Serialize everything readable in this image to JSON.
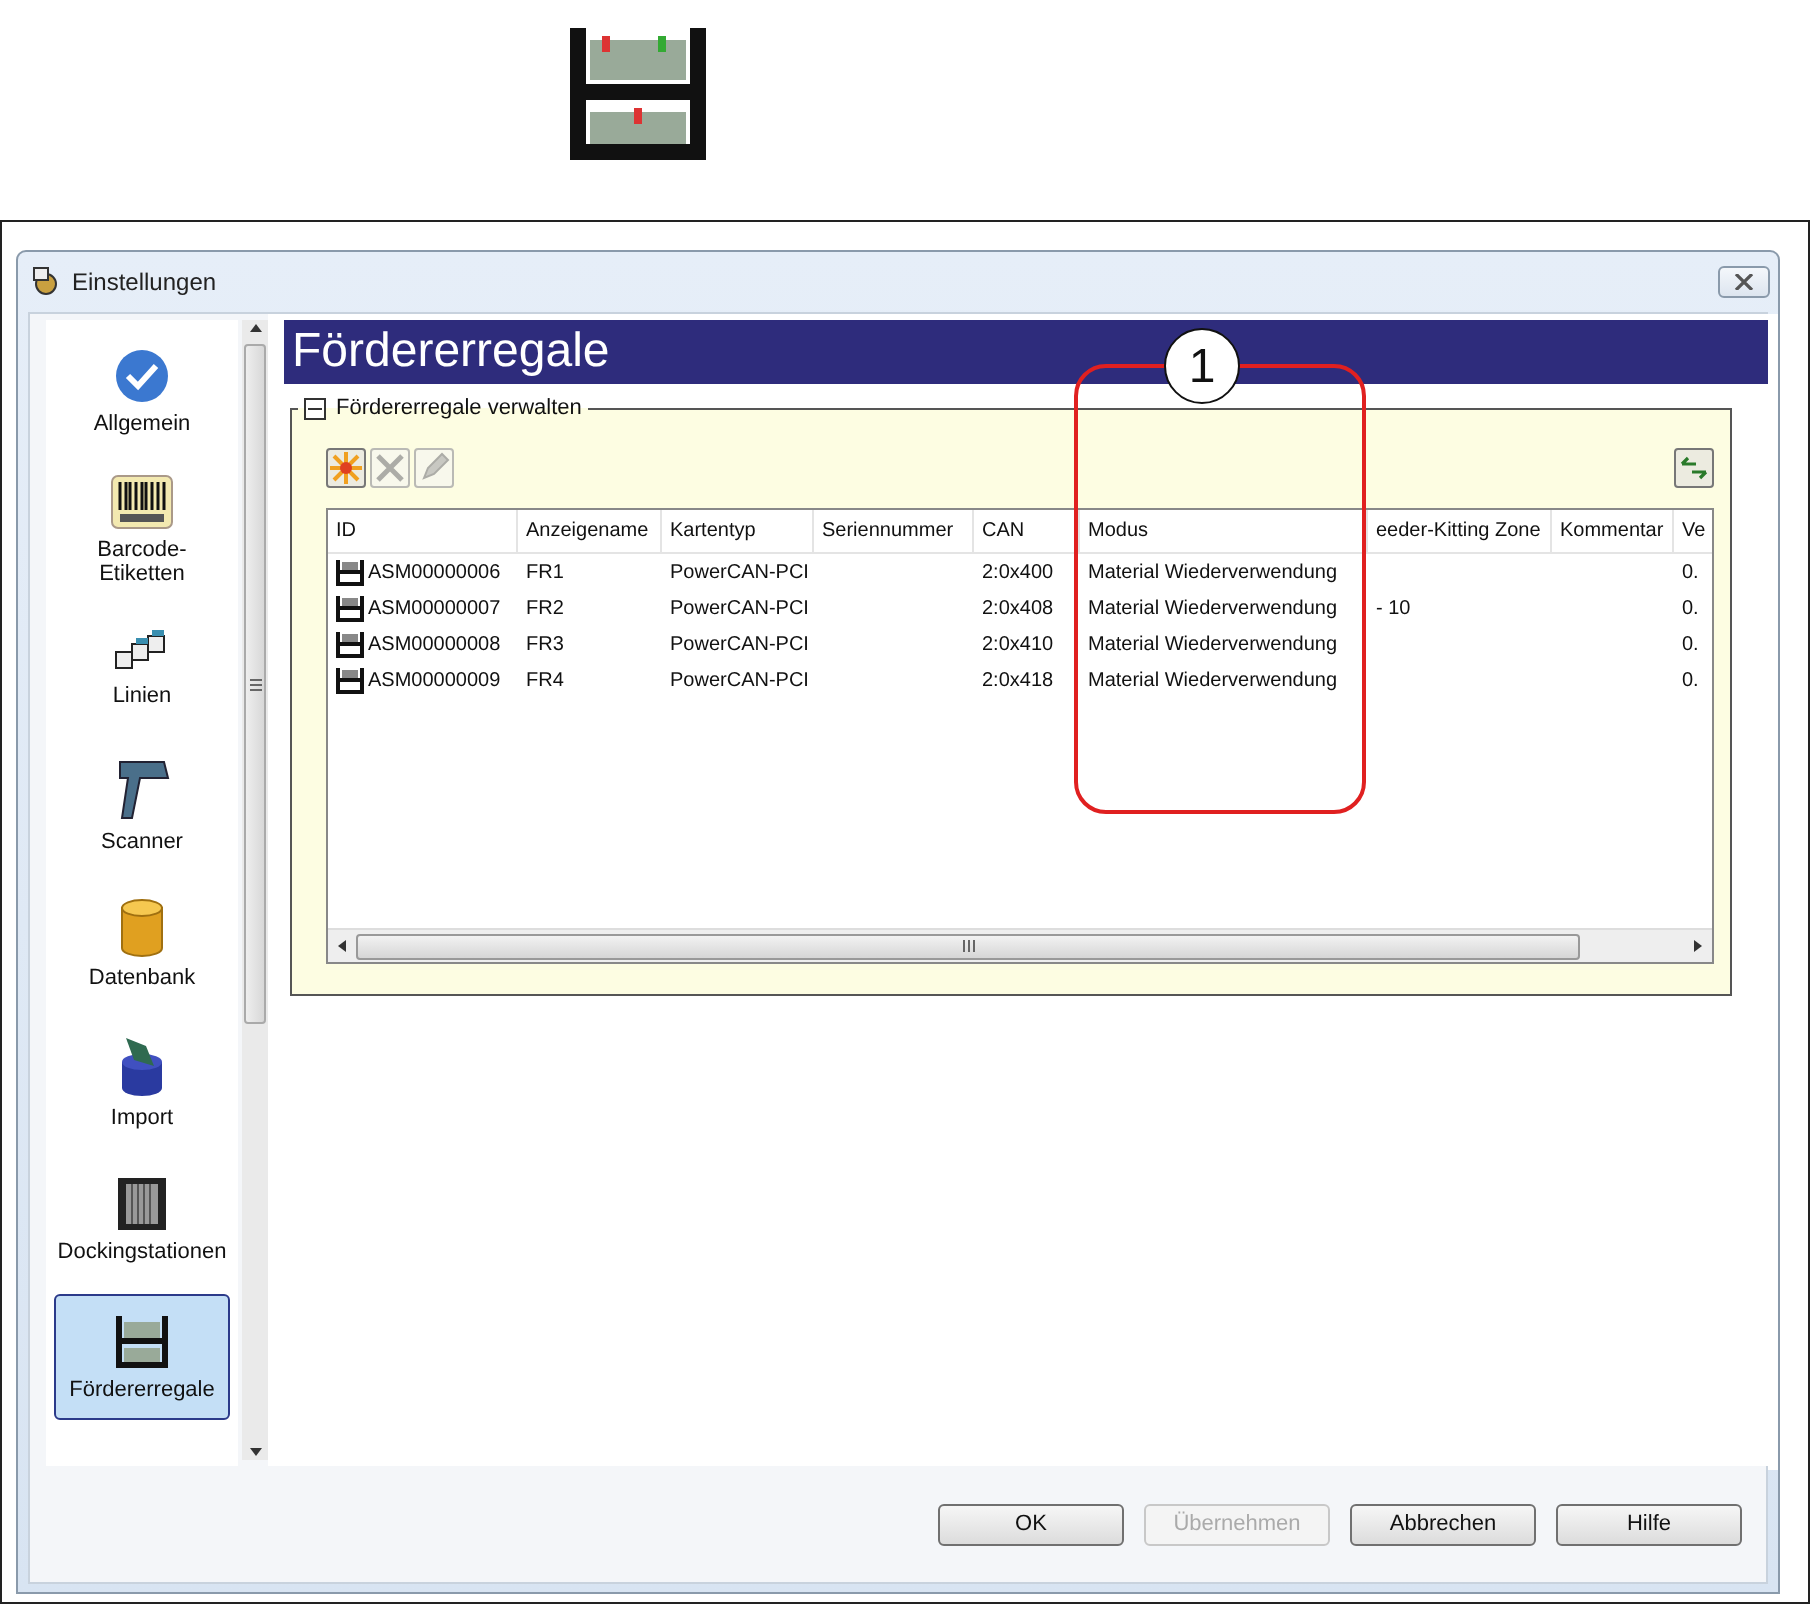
{
  "top_icon": {
    "kind": "rack"
  },
  "window": {
    "title": "Einstellungen"
  },
  "sidebar": {
    "items": [
      {
        "label": "Allgemein",
        "kind": "check",
        "selected": false
      },
      {
        "label": "Barcode-\nEtiketten",
        "kind": "barcode",
        "selected": false
      },
      {
        "label": "Linien",
        "kind": "lines",
        "selected": false
      },
      {
        "label": "Scanner",
        "kind": "scanner",
        "selected": false
      },
      {
        "label": "Datenbank",
        "kind": "database",
        "selected": false
      },
      {
        "label": "Import",
        "kind": "import",
        "selected": false
      },
      {
        "label": "Dockingstationen",
        "kind": "docking",
        "selected": false
      },
      {
        "label": "Fördererregale",
        "kind": "rack",
        "selected": true
      }
    ]
  },
  "page_title": "Fördererregale",
  "group": {
    "title": "Fördererregale verwalten",
    "expanded": true,
    "toolbar": [
      {
        "kind": "new",
        "disabled": false
      },
      {
        "kind": "delete",
        "disabled": true
      },
      {
        "kind": "edit",
        "disabled": true
      }
    ],
    "refresh": {
      "kind": "refresh"
    },
    "table": {
      "columns": [
        "ID",
        "Anzeigename",
        "Kartentyp",
        "Seriennummer",
        "CAN",
        "Modus",
        "eeder-Kitting Zone",
        "Kommentar",
        "Ve"
      ],
      "rows": [
        {
          "id": "ASM00000006",
          "anzeigename": "FR1",
          "kartentyp": "PowerCAN-PCI",
          "can": "2:0x400",
          "modus": "Material Wiederverwendung",
          "column_9": "0."
        },
        {
          "id": "ASM00000007",
          "anzeigename": "FR2",
          "kartentyp": "PowerCAN-PCI",
          "can": "2:0x408",
          "modus": "Material Wiederverwendung",
          "column_7": "- 10",
          "column_9": "0."
        },
        {
          "id": "ASM00000008",
          "anzeigename": "FR3",
          "kartentyp": "PowerCAN-PCI",
          "can": "2:0x410",
          "modus": "Material Wiederverwendung",
          "column_9": "0."
        },
        {
          "id": "ASM00000009",
          "anzeigename": "FR4",
          "kartentyp": "PowerCAN-PCI",
          "can": "2:0x418",
          "modus": "Material Wiederverwendung",
          "column_9": "0."
        }
      ]
    }
  },
  "buttons": [
    {
      "label": "OK",
      "disabled": false
    },
    {
      "label": "Übernehmen",
      "disabled": true
    },
    {
      "label": "Abbrechen",
      "disabled": false
    },
    {
      "label": "Hilfe",
      "disabled": false
    }
  ],
  "callout": {
    "label": "1"
  }
}
